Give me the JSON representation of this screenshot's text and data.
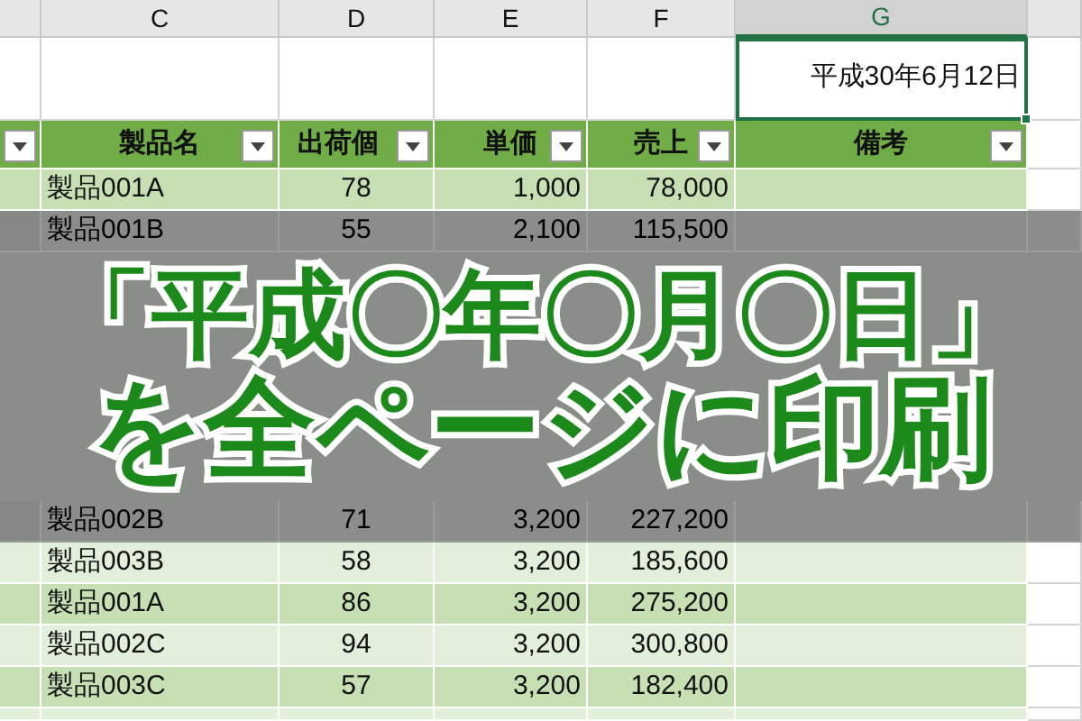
{
  "column_headers": [
    {
      "label": "C",
      "selected": false
    },
    {
      "label": "D",
      "selected": false
    },
    {
      "label": "E",
      "selected": false
    },
    {
      "label": "F",
      "selected": false
    },
    {
      "label": "G",
      "selected": true
    }
  ],
  "date_cell": {
    "text": "平成30年6月12日",
    "selected": true
  },
  "table": {
    "columns": [
      {
        "label": "製品名"
      },
      {
        "label": "出荷個"
      },
      {
        "label": "単価"
      },
      {
        "label": "売上"
      },
      {
        "label": "備考"
      }
    ],
    "rows": [
      {
        "product": "製品001A",
        "quantity": "78",
        "unit_price": "1,000",
        "sales": "78,000"
      },
      {
        "product": "製品001B",
        "quantity": "55",
        "unit_price": "2,100",
        "sales": "115,500",
        "dimmed": true
      },
      {
        "product": "製品002B",
        "quantity": "71",
        "unit_price": "3,200",
        "sales": "227,200",
        "dimmed": true
      },
      {
        "product": "製品003B",
        "quantity": "58",
        "unit_price": "3,200",
        "sales": "185,600"
      },
      {
        "product": "製品001A",
        "quantity": "86",
        "unit_price": "3,200",
        "sales": "275,200"
      },
      {
        "product": "製品002C",
        "quantity": "94",
        "unit_price": "3,200",
        "sales": "300,800"
      },
      {
        "product": "製品003C",
        "quantity": "57",
        "unit_price": "3,200",
        "sales": "182,400"
      },
      {}
    ]
  },
  "banner": {
    "lines": [
      "「平成〇年〇月〇日」",
      "を全ページに印刷"
    ]
  }
}
